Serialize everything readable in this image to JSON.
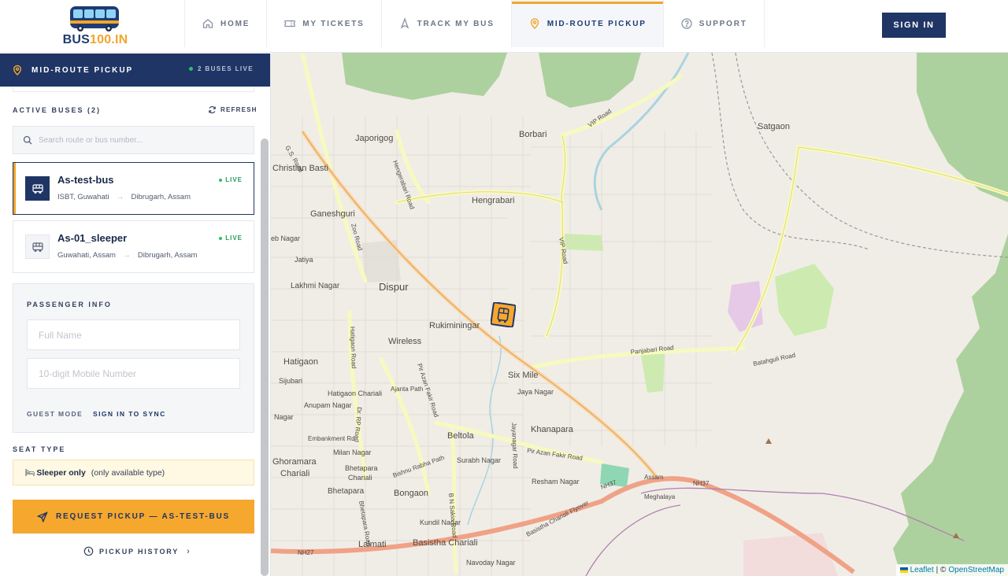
{
  "brand": {
    "name_main": "BUS",
    "name_accent": "100.IN"
  },
  "nav": {
    "tabs": [
      {
        "label": "HOME",
        "icon": "home-icon"
      },
      {
        "label": "MY TICKETS",
        "icon": "ticket-icon"
      },
      {
        "label": "TRACK MY BUS",
        "icon": "navigation-icon"
      },
      {
        "label": "MID-ROUTE PICKUP",
        "icon": "location-pin-icon",
        "active": true
      },
      {
        "label": "SUPPORT",
        "icon": "help-circle-icon"
      }
    ],
    "sign_in": "SIGN IN"
  },
  "sidebar": {
    "title": "MID-ROUTE PICKUP",
    "live_status": "2 BUSES LIVE",
    "active_buses_label": "ACTIVE BUSES (2)",
    "refresh_label": "REFRESH",
    "search_placeholder": "Search route or bus number...",
    "buses": [
      {
        "name": "As-test-bus",
        "from": "ISBT, Guwahati",
        "to": "Dibrugarh, Assam",
        "status": "LIVE",
        "selected": true
      },
      {
        "name": "As-01_sleeper",
        "from": "Guwahati, Assam",
        "to": "Dibrugarh, Assam",
        "status": "LIVE",
        "selected": false
      }
    ],
    "passenger": {
      "label": "PASSENGER INFO",
      "name_placeholder": "Full Name",
      "mobile_placeholder": "10-digit Mobile Number",
      "guest_mode": "GUEST MODE",
      "sign_in_sync": "SIGN IN TO SYNC"
    },
    "seat": {
      "label": "SEAT TYPE",
      "type": "Sleeper only",
      "note": "(only available type)"
    },
    "request_button": "REQUEST PICKUP — AS-TEST-BUS",
    "history_label": "PICKUP HISTORY"
  },
  "map": {
    "labels": {
      "japorigog": "Japorigog",
      "borbari": "Borbari",
      "satgaon": "Satgaon",
      "christian_basti": "Christian Basti",
      "hengrabari": "Hengrabari",
      "ganeshguri": "Ganeshguri",
      "eb_nagar": "eb Nagar",
      "jatiya": "Jatiya",
      "lakhmi_nagar": "Lakhmi Nagar",
      "dispur": "Dispur",
      "rukmini_nagar": "Rukiminingar",
      "wireless": "Wireless",
      "hatigaon": "Hatigaon",
      "six_mile": "Six Mile",
      "sijubari": "Sijubari",
      "hatigaon_chariali": "Hatigaon Chariali",
      "ajanta_path": "Ajanta Path",
      "jaya_nagar": "Jaya Nagar",
      "anupam_nagar": "Anupam Nagar",
      "khanapara": "Khanapara",
      "nagar": "Nagar",
      "beltola": "Beltola",
      "embankment_rd": "Embankment Rd",
      "milan_nagar": "Milan Nagar",
      "ghoramara": "Ghoramara",
      "chariali": "Chariali",
      "bhetapara_1": "Bhetapara",
      "chariali_2": "Chariali",
      "surabh_nagar": "Surabh Nagar",
      "resham_nagar": "Resham Nagar",
      "bhetapara_2": "Bhetapara",
      "bongaon": "Bongaon",
      "kundil_nagar": "Kundil Nagar",
      "lalmati": "Lalmati",
      "basistha_chariali": "Basistha Chariali",
      "navoday_nagar": "Navoday Nagar",
      "assam": "Assam",
      "meghalaya": "Meghalaya",
      "nh27": "NH27",
      "nh37": "NH37",
      "nh37b": "NH37",
      "vip_road": "VIP Road",
      "vip_road_2": "VIP Road",
      "gs_road": "G.S. Road",
      "zoo_road": "Zoo Road",
      "hengerabari_road": "Hengerabari Road",
      "hatigaon_road": "Hatigaon Road",
      "pir_azan_fakir_road": "Pir Azan Fakir Road",
      "pir_azan_fakir_road_2": "Pir Azan Fakir Road",
      "panjabari_road": "Panjabari Road",
      "batahguli_road": "Batahguli Road",
      "dr_rp_road": "Dr. RP Road",
      "jayanagar_road": "Jayanagar Road",
      "bishnu_rabha_path": "Bishnu Rabha Path",
      "b_n_sakia_road": "B N Sakia Road",
      "bhetapara_road": "Bhetapara Road",
      "basistha_flyover": "Basistha Chariali Flyover"
    },
    "attribution": {
      "leaflet": "Leaflet",
      "sep": "| ©",
      "osm": "OpenStreetMap"
    }
  }
}
